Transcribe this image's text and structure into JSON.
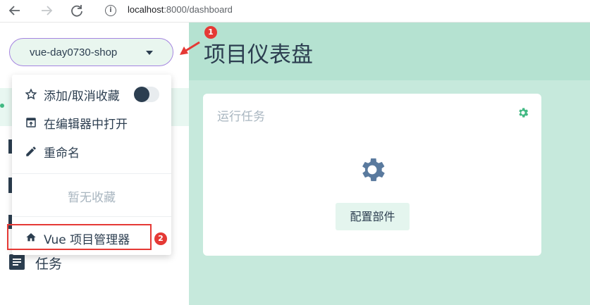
{
  "browser": {
    "url_host": "localhost",
    "url_path": ":8000/dashboard",
    "icons": [
      "back-arrow-icon",
      "forward-arrow-icon",
      "reload-icon",
      "info-icon"
    ]
  },
  "project_selector": {
    "label": "vue-day0730-shop"
  },
  "dropdown": {
    "items": [
      {
        "label": "添加/取消收藏",
        "icon": "star-outline-icon",
        "toggle_on": true
      },
      {
        "label": "在编辑器中打开",
        "icon": "open-in-editor-icon"
      },
      {
        "label": "重命名",
        "icon": "pencil-icon"
      }
    ],
    "empty_favorites": "暂无收藏",
    "project_manager": {
      "label": "Vue 项目管理器",
      "icon": "home-icon"
    }
  },
  "annotations": {
    "badge1": "1",
    "badge2": "2"
  },
  "sidebar": {
    "tasks_label": "任务"
  },
  "main": {
    "title": "项目仪表盘",
    "card": {
      "title": "运行任务",
      "button": "配置部件"
    }
  },
  "colors": {
    "accent": "#42b983",
    "gear": "#5a7a9e",
    "main_bg": "#c6e9dc",
    "header_bg": "#b5e2d1",
    "annotation_red": "#e53935",
    "selector_border": "#a585e0"
  }
}
